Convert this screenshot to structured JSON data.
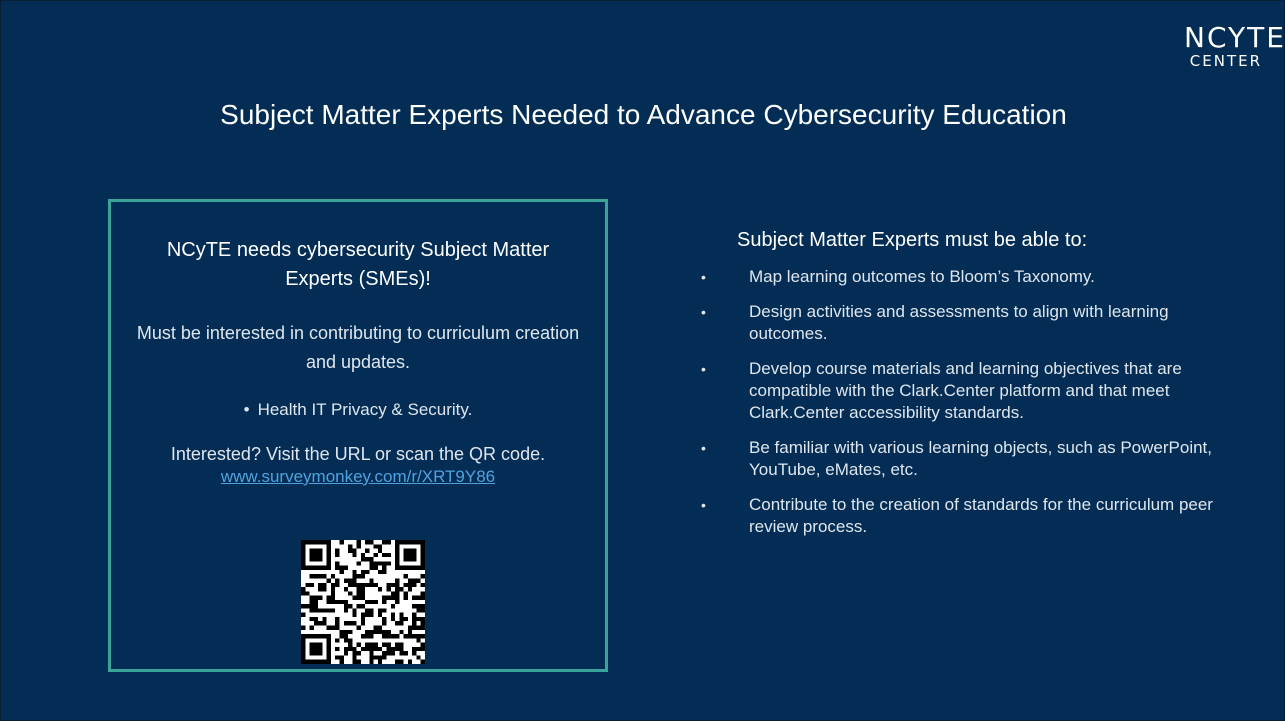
{
  "logo": {
    "line1": "NCYTE",
    "line2": "CENTER"
  },
  "title": "Subject Matter Experts Needed to Advance Cybersecurity Education",
  "callout": {
    "heading": "NCyTE needs cybersecurity Subject Matter Experts (SMEs)!",
    "text": "Must be interested in contributing to curriculum creation and updates.",
    "bullet": "Health IT Privacy & Security.",
    "cta": "Interested? Visit the URL or scan the QR code.",
    "link": "www.surveymonkey.com/r/XRT9Y86"
  },
  "requirements": {
    "heading": "Subject Matter Experts must be able to:",
    "items": [
      "Map learning outcomes to Bloom’s Taxonomy.",
      "Design activities and assessments to align with learning outcomes.",
      "Develop course materials and learning objectives that are compatible with the Clark.Center platform and that meet Clark.Center accessibility standards.",
      "Be familiar with various learning objects, such as PowerPoint, YouTube, eMates, etc.",
      "Contribute to the creation of standards for the curriculum peer review process."
    ]
  },
  "colors": {
    "background": "#032d55",
    "accent_border": "#3aa49a",
    "link": "#4fa3e0"
  },
  "icons": {
    "qr": "qr-code-icon",
    "bullet": "bullet-dot-icon"
  }
}
